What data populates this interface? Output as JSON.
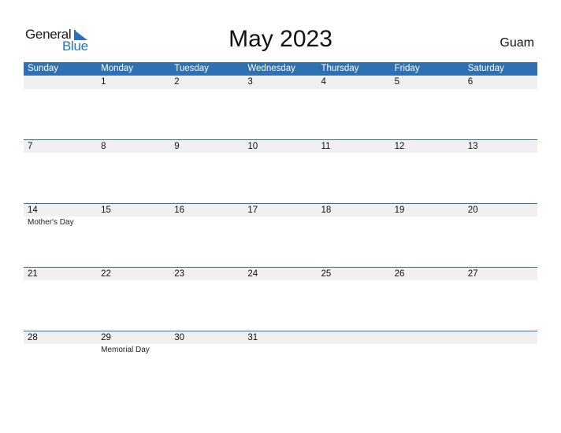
{
  "logo": {
    "line1": "General",
    "line2": "Blue",
    "icon": "triangle-flag-icon"
  },
  "title": "May 2023",
  "country": "Guam",
  "colors": {
    "accent": "#2e70b1",
    "row_bg": "#f0f0f0"
  },
  "days": [
    "Sunday",
    "Monday",
    "Tuesday",
    "Wednesday",
    "Thursday",
    "Friday",
    "Saturday"
  ],
  "weeks": [
    {
      "dates": [
        "",
        "1",
        "2",
        "3",
        "4",
        "5",
        "6"
      ],
      "events": [
        "",
        "",
        "",
        "",
        "",
        "",
        ""
      ]
    },
    {
      "dates": [
        "7",
        "8",
        "9",
        "10",
        "11",
        "12",
        "13"
      ],
      "events": [
        "",
        "",
        "",
        "",
        "",
        "",
        ""
      ]
    },
    {
      "dates": [
        "14",
        "15",
        "16",
        "17",
        "18",
        "19",
        "20"
      ],
      "events": [
        "Mother's Day",
        "",
        "",
        "",
        "",
        "",
        ""
      ]
    },
    {
      "dates": [
        "21",
        "22",
        "23",
        "24",
        "25",
        "26",
        "27"
      ],
      "events": [
        "",
        "",
        "",
        "",
        "",
        "",
        ""
      ]
    },
    {
      "dates": [
        "28",
        "29",
        "30",
        "31",
        "",
        "",
        ""
      ],
      "events": [
        "",
        "Memorial Day",
        "",
        "",
        "",
        "",
        ""
      ]
    }
  ]
}
